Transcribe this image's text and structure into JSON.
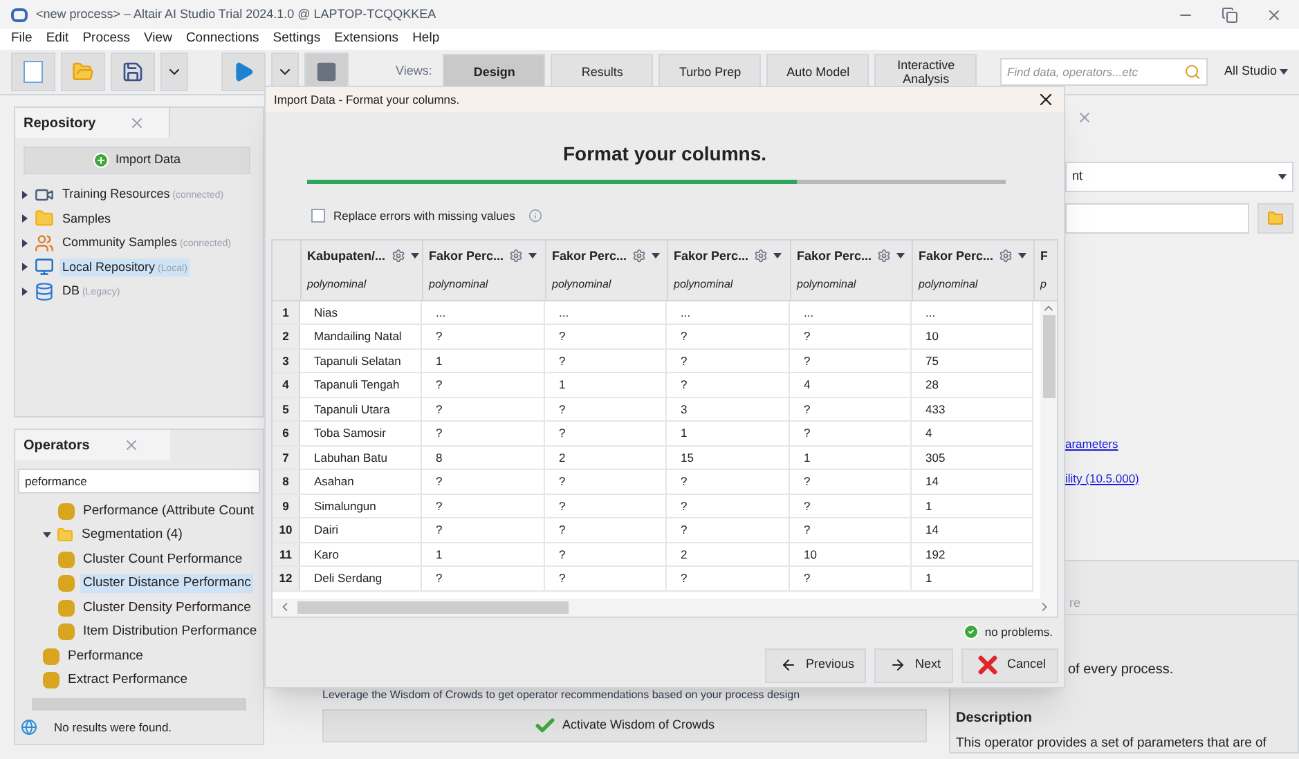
{
  "window": {
    "title": "<new process> – Altair AI Studio Trial 2024.1.0 @ LAPTOP-TCQQKKEA"
  },
  "menu": [
    "File",
    "Edit",
    "Process",
    "View",
    "Connections",
    "Settings",
    "Extensions",
    "Help"
  ],
  "toolbar": {
    "views_label": "Views:",
    "views": [
      {
        "label": "Design",
        "selected": true
      },
      {
        "label": "Results",
        "selected": false
      },
      {
        "label": "Turbo Prep",
        "selected": false
      },
      {
        "label": "Auto Model",
        "selected": false
      },
      {
        "label": "Interactive Analysis",
        "selected": false
      }
    ],
    "search": {
      "placeholder": "Find data, operators...etc"
    },
    "scope": "All Studio"
  },
  "repository": {
    "title": "Repository",
    "import_button": "Import Data",
    "items": [
      {
        "kind": "training",
        "label": "Training Resources",
        "note": "(connected)",
        "selected": false
      },
      {
        "kind": "folder",
        "label": "Samples",
        "selected": false
      },
      {
        "kind": "community",
        "label": "Community Samples",
        "note": "(connected)",
        "selected": false
      },
      {
        "kind": "local",
        "label": "Local Repository",
        "note": "(Local)",
        "selected": true
      },
      {
        "kind": "db",
        "label": "DB",
        "note": "(Legacy)",
        "selected": false
      }
    ]
  },
  "operators": {
    "title": "Operators",
    "search_value": "peformance",
    "tree": [
      {
        "children": [
          {
            "kind": "operator",
            "label": "Performance (Attribute Count",
            "selected": false
          }
        ]
      },
      {
        "kind": "folder",
        "label": "Segmentation (4)",
        "expanded": true,
        "selected": false,
        "children": [
          {
            "kind": "operator",
            "label": "Cluster Count Performance",
            "selected": false
          },
          {
            "kind": "operator",
            "label": "Cluster Distance Performanc",
            "selected": true
          },
          {
            "kind": "operator",
            "label": "Cluster Density Performance",
            "selected": false
          },
          {
            "kind": "operator",
            "label": "Item Distribution Performance",
            "selected": false
          }
        ]
      },
      {
        "kind": "operator",
        "label": "Performance",
        "selected": false
      },
      {
        "kind": "operator",
        "label": "Extract Performance",
        "selected": false
      }
    ],
    "status": "No results were found."
  },
  "wisdom": {
    "text": "Leverage the Wisdom of Crowds to get operator recommendations based on your process design",
    "button": "Activate Wisdom of Crowds"
  },
  "right_panel": {
    "dropdown_value": "nt",
    "links": [
      "arameters",
      "ility (10.5.000)"
    ],
    "partial_heading": "re",
    "partial_text": "of every process.",
    "description_title": "Description",
    "description": "This operator provides a set of parameters that are of"
  },
  "dialog": {
    "title": "Import Data - Format your columns.",
    "heading": "Format your columns.",
    "progress": {
      "level": 0.7
    },
    "replace_errors": {
      "label": "Replace errors with missing values",
      "checked": false
    },
    "columns": [
      {
        "name": "Kabupaten/...",
        "type": "polynominal"
      },
      {
        "name": "Fakor Perc...",
        "type": "polynominal"
      },
      {
        "name": "Fakor Perc...",
        "type": "polynominal"
      },
      {
        "name": "Fakor Perc...",
        "type": "polynominal"
      },
      {
        "name": "Fakor Perc...",
        "type": "polynominal"
      },
      {
        "name": "Fakor Perc...",
        "type": "polynominal"
      },
      {
        "name": "F",
        "type": "p"
      }
    ],
    "rows": [
      {
        "number": "1",
        "cells": [
          "Nias",
          "...",
          "...",
          "...",
          "...",
          "..."
        ]
      },
      {
        "number": "2",
        "cells": [
          "Mandailing Natal",
          "?",
          "?",
          "?",
          "?",
          "10"
        ]
      },
      {
        "number": "3",
        "cells": [
          "Tapanuli Selatan",
          "1",
          "?",
          "?",
          "?",
          "75"
        ]
      },
      {
        "number": "4",
        "cells": [
          "Tapanuli Tengah",
          "?",
          "1",
          "?",
          "4",
          "28"
        ]
      },
      {
        "number": "5",
        "cells": [
          "Tapanuli Utara",
          "?",
          "?",
          "3",
          "?",
          "433"
        ]
      },
      {
        "number": "6",
        "cells": [
          "Toba Samosir",
          "?",
          "?",
          "1",
          "?",
          "4"
        ]
      },
      {
        "number": "7",
        "cells": [
          "Labuhan Batu",
          "8",
          "2",
          "15",
          "1",
          "305"
        ]
      },
      {
        "number": "8",
        "cells": [
          "Asahan",
          "?",
          "?",
          "?",
          "?",
          "14"
        ]
      },
      {
        "number": "9",
        "cells": [
          "Simalungun",
          "?",
          "?",
          "?",
          "?",
          "1"
        ]
      },
      {
        "number": "10",
        "cells": [
          "Dairi",
          "?",
          "?",
          "?",
          "?",
          "14"
        ]
      },
      {
        "number": "11",
        "cells": [
          "Karo",
          "1",
          "?",
          "2",
          "10",
          "192"
        ]
      },
      {
        "number": "12",
        "cells": [
          "Deli Serdang",
          "?",
          "?",
          "?",
          "?",
          "1"
        ]
      }
    ],
    "status": "no problems.",
    "buttons": [
      {
        "kind": "previous",
        "label": "Previous"
      },
      {
        "kind": "next",
        "label": "Next"
      },
      {
        "kind": "cancel",
        "label": "Cancel"
      }
    ]
  }
}
